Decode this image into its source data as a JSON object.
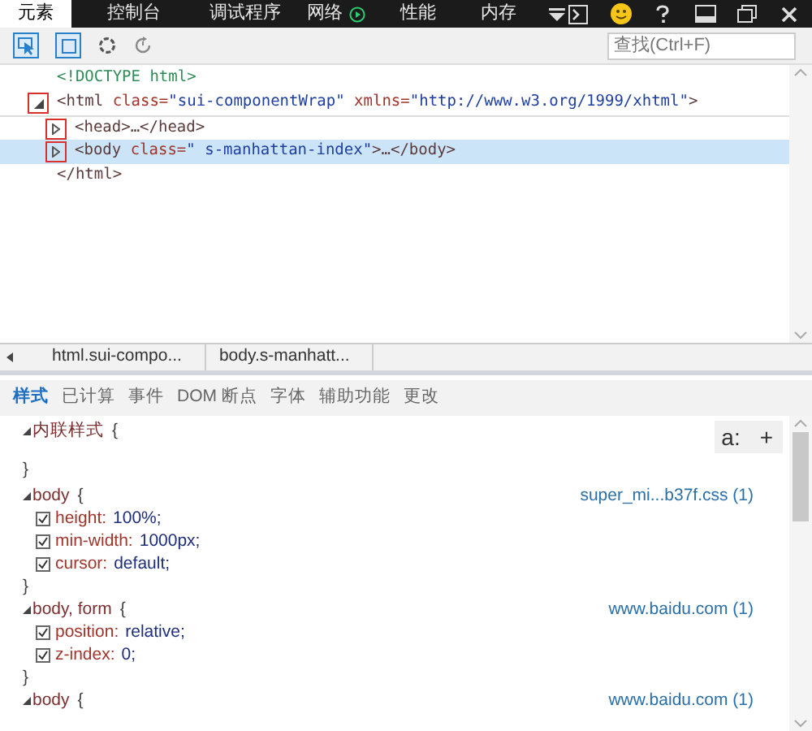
{
  "top_tabs": [
    {
      "label": "元素",
      "selected": true
    },
    {
      "label": "控制台",
      "selected": false
    },
    {
      "label": "调试程序",
      "selected": false
    },
    {
      "label": "网络",
      "selected": false,
      "recording": true
    },
    {
      "label": "性能",
      "selected": false
    },
    {
      "label": "内存",
      "selected": false
    }
  ],
  "toolbar": {
    "search": {
      "placeholder": "查找(Ctrl+F)"
    }
  },
  "dom_tree": [
    {
      "tokens": [
        {
          "kind": "doctype",
          "text": "<!DOCTYPE html>"
        }
      ],
      "selected": false
    },
    {
      "tokens": [
        {
          "kind": "tag",
          "text": "<html "
        },
        {
          "kind": "attr",
          "text": "class="
        },
        {
          "kind": "value",
          "text": "\"sui-componentWrap\""
        },
        {
          "kind": "attr",
          "text": " xmlns="
        },
        {
          "kind": "value",
          "text": "\"http://www.w3.org/1999/xhtml\""
        },
        {
          "kind": "tag",
          "text": ">"
        }
      ],
      "selected": false,
      "expanded": true,
      "children": [
        {
          "tokens": [
            {
              "kind": "tag",
              "text": "<head>…</head>"
            }
          ],
          "selected": false,
          "expanded": false
        },
        {
          "tokens": [
            {
              "kind": "tag",
              "text": "<body "
            },
            {
              "kind": "attr",
              "text": "class="
            },
            {
              "kind": "value",
              "text": "\" s-manhattan-index\""
            },
            {
              "kind": "tag",
              "text": ">…</body>"
            }
          ],
          "selected": true,
          "expanded": false
        }
      ]
    },
    {
      "tokens": [
        {
          "kind": "tag",
          "text": "</html>"
        }
      ],
      "selected": false
    }
  ],
  "breadcrumb": [
    "html.sui-compo...",
    "body.s-manhatt..."
  ],
  "style_tabs": [
    {
      "label": "样式",
      "selected": true
    },
    {
      "label": "已计算",
      "selected": false
    },
    {
      "label": "事件",
      "selected": false
    },
    {
      "label": "DOM 断点",
      "selected": false
    },
    {
      "label": "字体",
      "selected": false
    },
    {
      "label": "辅助功能",
      "selected": false
    },
    {
      "label": "更改",
      "selected": false
    }
  ],
  "style_buttons": [
    "a:",
    "+"
  ],
  "rules": [
    {
      "selector": "内联样式",
      "open": "{",
      "close": "}"
    },
    {
      "selector": "body",
      "open": "{",
      "close": "}",
      "source": "super_mi...b37f.css (1)",
      "properties": [
        {
          "name": "height:",
          "value": "100%;",
          "checked": true
        },
        {
          "name": "min-width:",
          "value": "1000px;",
          "checked": true
        },
        {
          "name": "cursor:",
          "value": "default;",
          "checked": true
        }
      ]
    },
    {
      "selector": "body, form",
      "open": "{",
      "close": "}",
      "source": "www.baidu.com (1)",
      "properties": [
        {
          "name": "position:",
          "value": "relative;",
          "checked": true
        },
        {
          "name": "z-index:",
          "value": "0;",
          "checked": true
        }
      ]
    },
    {
      "selector": "body",
      "open": "{",
      "source": "www.baidu.com (1)"
    }
  ]
}
